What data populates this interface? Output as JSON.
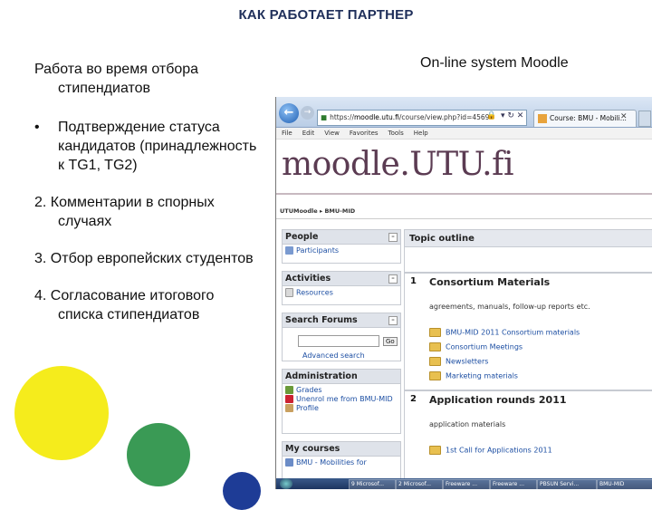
{
  "slide": {
    "title": "КАК РАБОТАЕТ ПАРТНЕР",
    "left_heading": "Работа во время отбора стипендиатов",
    "bullet_marker": "•",
    "bullet_text": "Подтверждение статуса кандидатов (принадлежность к TG1, TG2)",
    "item2": "2. Комментарии в спорных случаях",
    "item3": "3. Отбор европейских студентов",
    "item4": "4. Согласование итогового списка стипендиатов",
    "right_caption": "On-line system Moodle",
    "circle_colors": [
      "#f5ec1c",
      "#3a9a55",
      "#1e3c96"
    ]
  },
  "browser": {
    "back_label": "←",
    "forward_label": "→",
    "address_prefix": "https://",
    "address_host": "moodle.utu.fi",
    "address_path": "/course/view.php?id=4569",
    "address_lock": "🔒",
    "address_controls": "▾ ↻ ✕",
    "tab_label": "Course: BMU - Mobili...",
    "tab_close": "✕",
    "menu": [
      "File",
      "Edit",
      "View",
      "Favorites",
      "Tools",
      "Help"
    ]
  },
  "moodle": {
    "logo": "moodle.UTU.fi",
    "breadcrumb": "UTUMoodle ▸ BMU-MID",
    "blocks": {
      "people": {
        "title": "People",
        "items": [
          "Participants"
        ]
      },
      "activities": {
        "title": "Activities",
        "items": [
          "Resources"
        ]
      },
      "search": {
        "title": "Search Forums",
        "go_label": "Go",
        "advanced": "Advanced search"
      },
      "administration": {
        "title": "Administration",
        "items": [
          "Grades",
          "Unenrol me from BMU-MID",
          "Profile"
        ]
      },
      "mycourses": {
        "title": "My courses",
        "items": [
          "BMU - Mobilities for"
        ]
      }
    },
    "block_min": "–",
    "topic_outline": "Topic outline",
    "sections": [
      {
        "num": "1",
        "title": "Consortium Materials",
        "subtitle": "agreements, manuals, follow-up reports etc.",
        "items": [
          "BMU-MID 2011 Consortium materials",
          "Consortium Meetings",
          "Newsletters",
          "Marketing materials"
        ]
      },
      {
        "num": "2",
        "title": "Application rounds 2011",
        "subtitle": "application materials",
        "items": [
          "1st Call for Applications 2011"
        ]
      }
    ]
  },
  "taskbar": {
    "buttons": [
      "9 Microsof...",
      "2 Microsof...",
      "Freeware ...",
      "Freeware ...",
      "PBSUN Servi...",
      "BMU-MID"
    ]
  }
}
